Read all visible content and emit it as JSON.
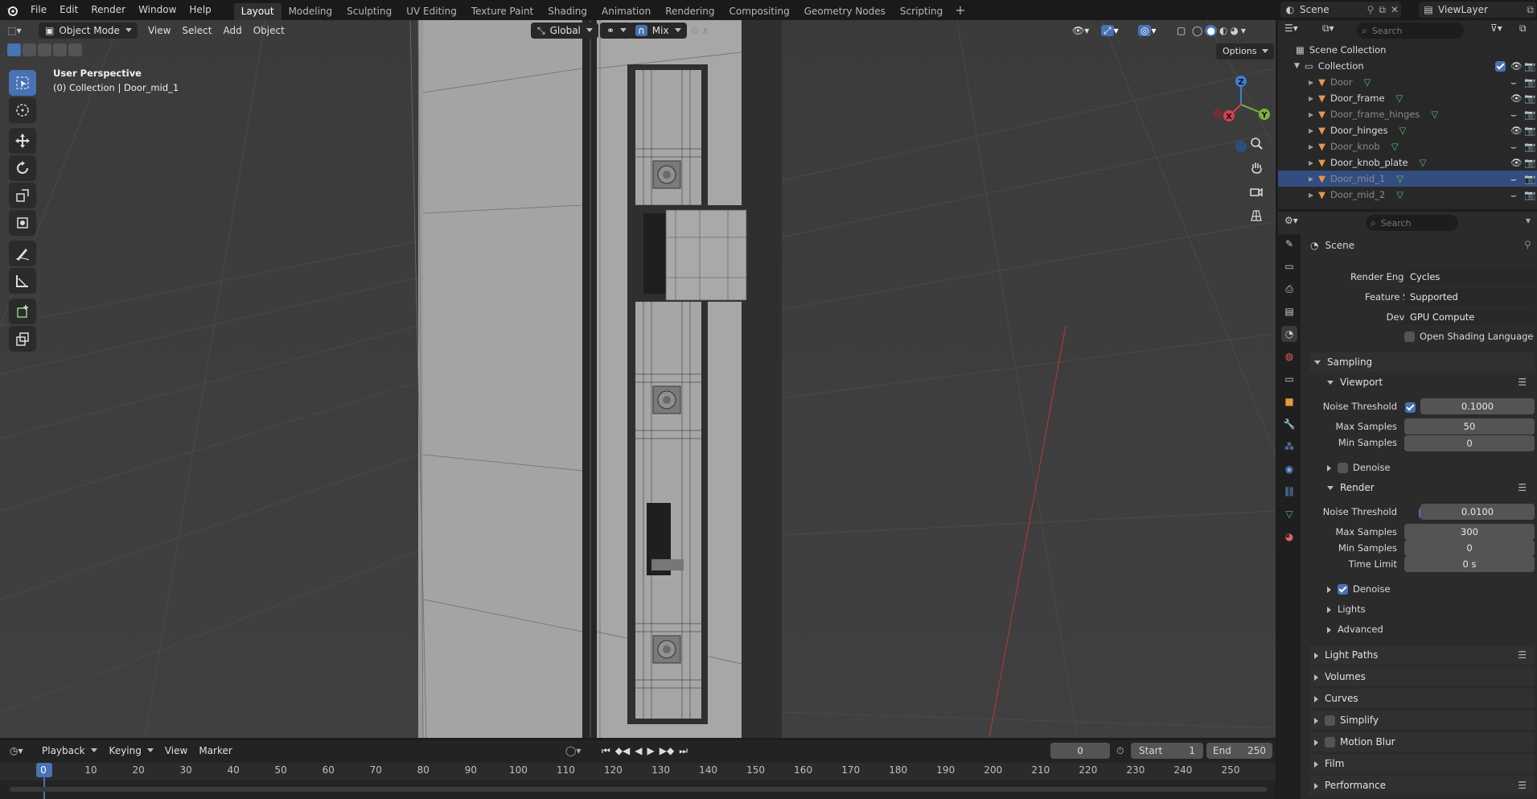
{
  "app": {
    "logo": "blender-logo-icon",
    "accent": "#4772b3"
  },
  "menu": [
    "File",
    "Edit",
    "Render",
    "Window",
    "Help"
  ],
  "workspaces": [
    "Layout",
    "Modeling",
    "Sculpting",
    "UV Editing",
    "Texture Paint",
    "Shading",
    "Animation",
    "Rendering",
    "Compositing",
    "Geometry Nodes",
    "Scripting"
  ],
  "active_workspace": "Layout",
  "topright": {
    "scene": "Scene",
    "view_layer": "ViewLayer"
  },
  "viewport": {
    "mode": "Object Mode",
    "menus": [
      "View",
      "Select",
      "Add",
      "Object"
    ],
    "orientation": "Global",
    "snap_mode": "Mix",
    "options_label": "Options",
    "overlay_title": "User Perspective",
    "overlay_subtitle": "(0) Collection | Door_mid_1",
    "gizmo": {
      "x": "X",
      "y": "Y",
      "z": "Z"
    }
  },
  "outliner": {
    "search_placeholder": "Search",
    "root": "Scene Collection",
    "collection": "Collection",
    "items": [
      {
        "name": "Door",
        "visible": false,
        "selected": false
      },
      {
        "name": "Door_frame",
        "visible": true,
        "selected": false
      },
      {
        "name": "Door_frame_hinges",
        "visible": false,
        "selected": false
      },
      {
        "name": "Door_hinges",
        "visible": true,
        "selected": false
      },
      {
        "name": "Door_knob",
        "visible": false,
        "selected": false
      },
      {
        "name": "Door_knob_plate",
        "visible": true,
        "selected": false
      },
      {
        "name": "Door_mid_1",
        "visible": false,
        "selected": true
      },
      {
        "name": "Door_mid_2",
        "visible": false,
        "selected": false
      }
    ]
  },
  "properties": {
    "search_placeholder": "Search",
    "context": "Scene",
    "render_engine_label": "Render Engine",
    "render_engine": "Cycles",
    "feature_set_label": "Feature Set",
    "feature_set": "Supported",
    "device_label": "Device",
    "device": "GPU Compute",
    "osl_label": "Open Shading Language",
    "sampling": "Sampling",
    "viewport_section": "Viewport",
    "render_section": "Render",
    "noise_threshold_label": "Noise Threshold",
    "max_samples_label": "Max Samples",
    "min_samples_label": "Min Samples",
    "time_limit_label": "Time Limit",
    "denoise_label": "Denoise",
    "viewport_noise_threshold": "0.1000",
    "viewport_max_samples": "50",
    "viewport_min_samples": "0",
    "render_noise_threshold": "0.0100",
    "render_max_samples": "300",
    "render_min_samples": "0",
    "render_time_limit": "0 s",
    "lights": "Lights",
    "advanced": "Advanced",
    "panels": [
      "Light Paths",
      "Volumes",
      "Curves",
      "Simplify",
      "Motion Blur",
      "Film",
      "Performance"
    ]
  },
  "timeline": {
    "menus": [
      "Playback",
      "Keying",
      "View",
      "Marker"
    ],
    "current_frame": "0",
    "start_label": "Start",
    "start": "1",
    "end_label": "End",
    "end": "250",
    "ruler": [
      "0",
      "10",
      "20",
      "30",
      "40",
      "50",
      "60",
      "70",
      "80",
      "90",
      "100",
      "110",
      "120",
      "130",
      "140",
      "150",
      "160",
      "170",
      "180",
      "190",
      "200",
      "210",
      "220",
      "230",
      "240",
      "250"
    ]
  }
}
